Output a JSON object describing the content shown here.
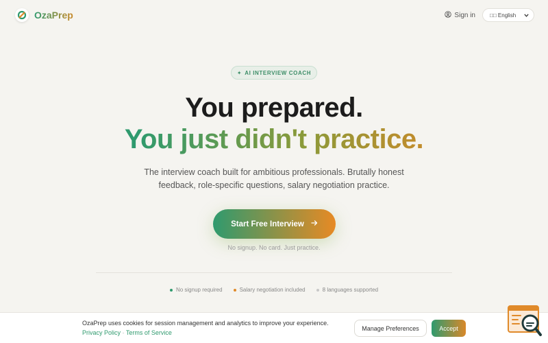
{
  "header": {
    "brand_name": "OzaPrep",
    "signin_label": "Sign in",
    "language": {
      "flag": "□□",
      "selected": "English"
    }
  },
  "hero": {
    "badge": {
      "symbol": "✦",
      "label": "AI INTERVIEW COACH"
    },
    "title_line1": "You prepared.",
    "title_line2_words": [
      "You",
      "just",
      "didn't",
      "practice."
    ],
    "subtitle_line1": "The interview coach built for ambitious professionals. Brutally honest",
    "subtitle_line2": "feedback, role-specific questions, salary negotiation practice.",
    "cta_label": "Start Free Interview",
    "cta_note": "No signup. No card. Just practice."
  },
  "features": [
    {
      "label": "No signup required",
      "color": "#2f9a6e"
    },
    {
      "label": "Salary negotiation included",
      "color": "#e08a2a"
    },
    {
      "label": "8 languages supported",
      "color": "#c8c8c8"
    }
  ],
  "cookie_bar": {
    "message": "OzaPrep uses cookies for session management and analytics to improve your experience.",
    "privacy_link": "Privacy Policy",
    "separator": "·",
    "terms_link": "Terms of Service",
    "manage_label": "Manage Preferences",
    "accept_label": "Accept"
  },
  "colors": {
    "brand_green": "#2f9a6e",
    "brand_orange": "#e08a2a",
    "background": "#f5f4f0"
  },
  "icons": {
    "logo": "ozaprep-logo-icon",
    "signin": "user-circle-icon",
    "language_chevron": "chevron-down-icon",
    "cta_arrow": "arrow-right-icon",
    "widget": "chat-search-widget-icon"
  }
}
